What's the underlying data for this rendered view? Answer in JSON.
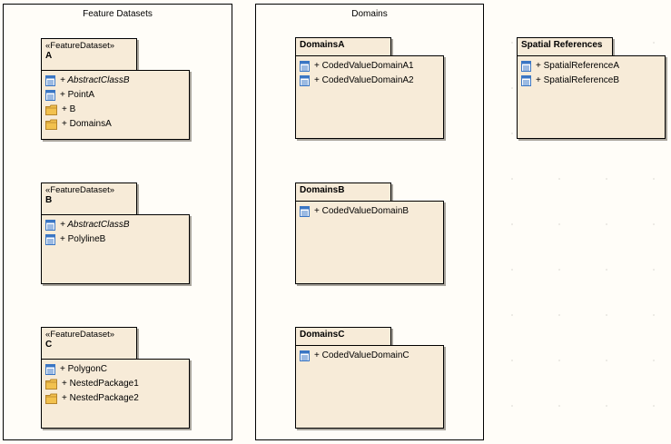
{
  "boundaries": [
    {
      "title": "Feature Datasets"
    },
    {
      "title": "Domains"
    }
  ],
  "packages": {
    "A": {
      "stereotype": "«FeatureDataset»",
      "name": "A",
      "items": [
        {
          "label": "+ AbstractClassB",
          "icon": "class-icon",
          "italic": true
        },
        {
          "label": "+ PointA",
          "icon": "class-icon",
          "italic": false
        },
        {
          "label": "+ B",
          "icon": "package-icon",
          "italic": false
        },
        {
          "label": "+ DomainsA",
          "icon": "package-icon",
          "italic": false
        }
      ]
    },
    "B": {
      "stereotype": "«FeatureDataset»",
      "name": "B",
      "items": [
        {
          "label": "+ AbstractClassB",
          "icon": "class-icon",
          "italic": true
        },
        {
          "label": "+ PolylineB",
          "icon": "class-icon",
          "italic": false
        }
      ]
    },
    "C": {
      "stereotype": "«FeatureDataset»",
      "name": "C",
      "items": [
        {
          "label": "+ PolygonC",
          "icon": "class-icon",
          "italic": false
        },
        {
          "label": "+ NestedPackage1",
          "icon": "package-icon",
          "italic": false
        },
        {
          "label": "+ NestedPackage2",
          "icon": "package-icon",
          "italic": false
        }
      ]
    },
    "DomainsA": {
      "name": "DomainsA",
      "items": [
        {
          "label": "+ CodedValueDomainA1",
          "icon": "class-icon",
          "italic": false
        },
        {
          "label": "+ CodedValueDomainA2",
          "icon": "class-icon",
          "italic": false
        }
      ]
    },
    "DomainsB": {
      "name": "DomainsB",
      "items": [
        {
          "label": "+ CodedValueDomainB",
          "icon": "class-icon",
          "italic": false
        }
      ]
    },
    "DomainsC": {
      "name": "DomainsC",
      "items": [
        {
          "label": "+ CodedValueDomainC",
          "icon": "class-icon",
          "italic": false
        }
      ]
    },
    "SpatialReferences": {
      "name": "Spatial References",
      "items": [
        {
          "label": "+ SpatialReferenceA",
          "icon": "class-icon",
          "italic": false
        },
        {
          "label": "+ SpatialReferenceB",
          "icon": "class-icon",
          "italic": false
        }
      ]
    }
  },
  "colors": {
    "canvas": "#fffdf8",
    "package_fill": "#f7ebd8",
    "class_icon_blue": "#3a76c4",
    "folder_icon_yellow": "#f2c14e"
  }
}
